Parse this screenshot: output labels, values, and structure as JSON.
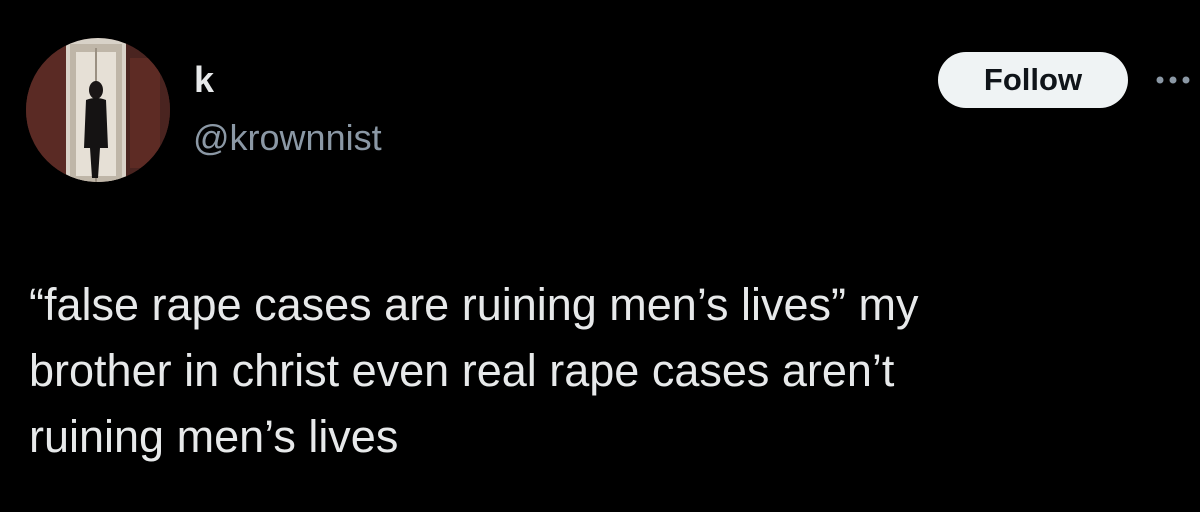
{
  "author": {
    "display_name": "k",
    "handle": "@krownnist",
    "avatar_icon": "profile-photo-avatar"
  },
  "actions": {
    "follow_label": "Follow",
    "more_icon": "more-horizontal-icon"
  },
  "tweet": {
    "lines": [
      "“false rape cases are ruining men’s lives” my",
      "brother in christ even real rape cases aren’t",
      "ruining men’s lives"
    ]
  },
  "colors": {
    "background": "#000000",
    "primary_text": "#e7e9ea",
    "secondary_text": "#8b98a5",
    "follow_bg": "#eff3f4",
    "follow_text": "#0f1419"
  }
}
